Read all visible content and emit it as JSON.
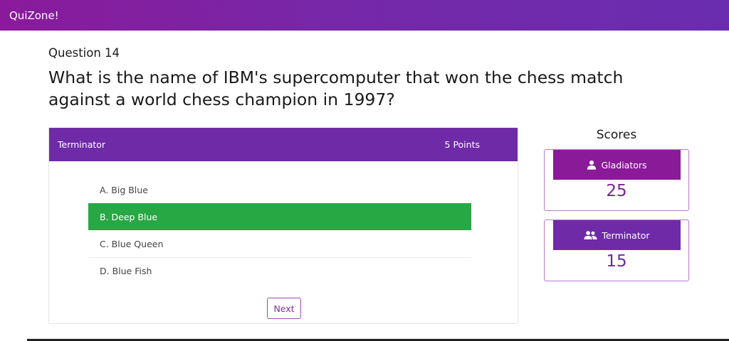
{
  "app": {
    "brand": "QuiZone!"
  },
  "question": {
    "number_label": "Question 14",
    "text": "What is the name of IBM's supercomputer that won the chess match against a world chess champion in 1997?"
  },
  "card": {
    "team": "Terminator",
    "points": "5 Points",
    "options": [
      {
        "label": "A. Big Blue"
      },
      {
        "label": "B. Deep Blue",
        "state": "correct"
      },
      {
        "label": "C. Blue Queen"
      },
      {
        "label": "D. Blue Fish"
      }
    ],
    "next_label": "Next"
  },
  "scores": {
    "title": "Scores",
    "teams": [
      {
        "name": "Gladiators",
        "score": "25",
        "icon": "user-icon"
      },
      {
        "name": "Terminator",
        "score": "15",
        "icon": "users-icon"
      }
    ]
  },
  "colors": {
    "header": "#6f2aa8",
    "correct": "#28a745",
    "gladiators": "#8b1a99"
  }
}
